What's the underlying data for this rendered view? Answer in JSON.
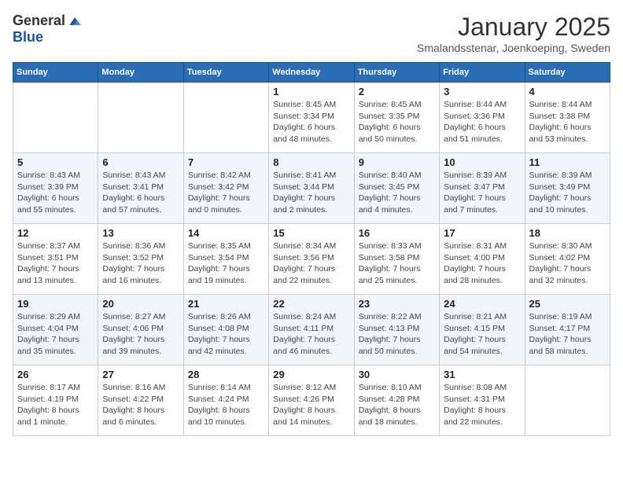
{
  "logo": {
    "general": "General",
    "blue": "Blue"
  },
  "title": "January 2025",
  "location": "Smalandsstenar, Joenkoeping, Sweden",
  "weekdays": [
    "Sunday",
    "Monday",
    "Tuesday",
    "Wednesday",
    "Thursday",
    "Friday",
    "Saturday"
  ],
  "weeks": [
    [
      {
        "day": "",
        "info": ""
      },
      {
        "day": "",
        "info": ""
      },
      {
        "day": "",
        "info": ""
      },
      {
        "day": "1",
        "info": "Sunrise: 8:45 AM\nSunset: 3:34 PM\nDaylight: 6 hours and 48 minutes."
      },
      {
        "day": "2",
        "info": "Sunrise: 8:45 AM\nSunset: 3:35 PM\nDaylight: 6 hours and 50 minutes."
      },
      {
        "day": "3",
        "info": "Sunrise: 8:44 AM\nSunset: 3:36 PM\nDaylight: 6 hours and 51 minutes."
      },
      {
        "day": "4",
        "info": "Sunrise: 8:44 AM\nSunset: 3:38 PM\nDaylight: 6 hours and 53 minutes."
      }
    ],
    [
      {
        "day": "5",
        "info": "Sunrise: 8:43 AM\nSunset: 3:39 PM\nDaylight: 6 hours and 55 minutes."
      },
      {
        "day": "6",
        "info": "Sunrise: 8:43 AM\nSunset: 3:41 PM\nDaylight: 6 hours and 57 minutes."
      },
      {
        "day": "7",
        "info": "Sunrise: 8:42 AM\nSunset: 3:42 PM\nDaylight: 7 hours and 0 minutes."
      },
      {
        "day": "8",
        "info": "Sunrise: 8:41 AM\nSunset: 3:44 PM\nDaylight: 7 hours and 2 minutes."
      },
      {
        "day": "9",
        "info": "Sunrise: 8:40 AM\nSunset: 3:45 PM\nDaylight: 7 hours and 4 minutes."
      },
      {
        "day": "10",
        "info": "Sunrise: 8:39 AM\nSunset: 3:47 PM\nDaylight: 7 hours and 7 minutes."
      },
      {
        "day": "11",
        "info": "Sunrise: 8:39 AM\nSunset: 3:49 PM\nDaylight: 7 hours and 10 minutes."
      }
    ],
    [
      {
        "day": "12",
        "info": "Sunrise: 8:37 AM\nSunset: 3:51 PM\nDaylight: 7 hours and 13 minutes."
      },
      {
        "day": "13",
        "info": "Sunrise: 8:36 AM\nSunset: 3:52 PM\nDaylight: 7 hours and 16 minutes."
      },
      {
        "day": "14",
        "info": "Sunrise: 8:35 AM\nSunset: 3:54 PM\nDaylight: 7 hours and 19 minutes."
      },
      {
        "day": "15",
        "info": "Sunrise: 8:34 AM\nSunset: 3:56 PM\nDaylight: 7 hours and 22 minutes."
      },
      {
        "day": "16",
        "info": "Sunrise: 8:33 AM\nSunset: 3:58 PM\nDaylight: 7 hours and 25 minutes."
      },
      {
        "day": "17",
        "info": "Sunrise: 8:31 AM\nSunset: 4:00 PM\nDaylight: 7 hours and 28 minutes."
      },
      {
        "day": "18",
        "info": "Sunrise: 8:30 AM\nSunset: 4:02 PM\nDaylight: 7 hours and 32 minutes."
      }
    ],
    [
      {
        "day": "19",
        "info": "Sunrise: 8:29 AM\nSunset: 4:04 PM\nDaylight: 7 hours and 35 minutes."
      },
      {
        "day": "20",
        "info": "Sunrise: 8:27 AM\nSunset: 4:06 PM\nDaylight: 7 hours and 39 minutes."
      },
      {
        "day": "21",
        "info": "Sunrise: 8:26 AM\nSunset: 4:08 PM\nDaylight: 7 hours and 42 minutes."
      },
      {
        "day": "22",
        "info": "Sunrise: 8:24 AM\nSunset: 4:11 PM\nDaylight: 7 hours and 46 minutes."
      },
      {
        "day": "23",
        "info": "Sunrise: 8:22 AM\nSunset: 4:13 PM\nDaylight: 7 hours and 50 minutes."
      },
      {
        "day": "24",
        "info": "Sunrise: 8:21 AM\nSunset: 4:15 PM\nDaylight: 7 hours and 54 minutes."
      },
      {
        "day": "25",
        "info": "Sunrise: 8:19 AM\nSunset: 4:17 PM\nDaylight: 7 hours and 58 minutes."
      }
    ],
    [
      {
        "day": "26",
        "info": "Sunrise: 8:17 AM\nSunset: 4:19 PM\nDaylight: 8 hours and 1 minute."
      },
      {
        "day": "27",
        "info": "Sunrise: 8:16 AM\nSunset: 4:22 PM\nDaylight: 8 hours and 6 minutes."
      },
      {
        "day": "28",
        "info": "Sunrise: 8:14 AM\nSunset: 4:24 PM\nDaylight: 8 hours and 10 minutes."
      },
      {
        "day": "29",
        "info": "Sunrise: 8:12 AM\nSunset: 4:26 PM\nDaylight: 8 hours and 14 minutes."
      },
      {
        "day": "30",
        "info": "Sunrise: 8:10 AM\nSunset: 4:28 PM\nDaylight: 8 hours and 18 minutes."
      },
      {
        "day": "31",
        "info": "Sunrise: 8:08 AM\nSunset: 4:31 PM\nDaylight: 8 hours and 22 minutes."
      },
      {
        "day": "",
        "info": ""
      }
    ]
  ]
}
